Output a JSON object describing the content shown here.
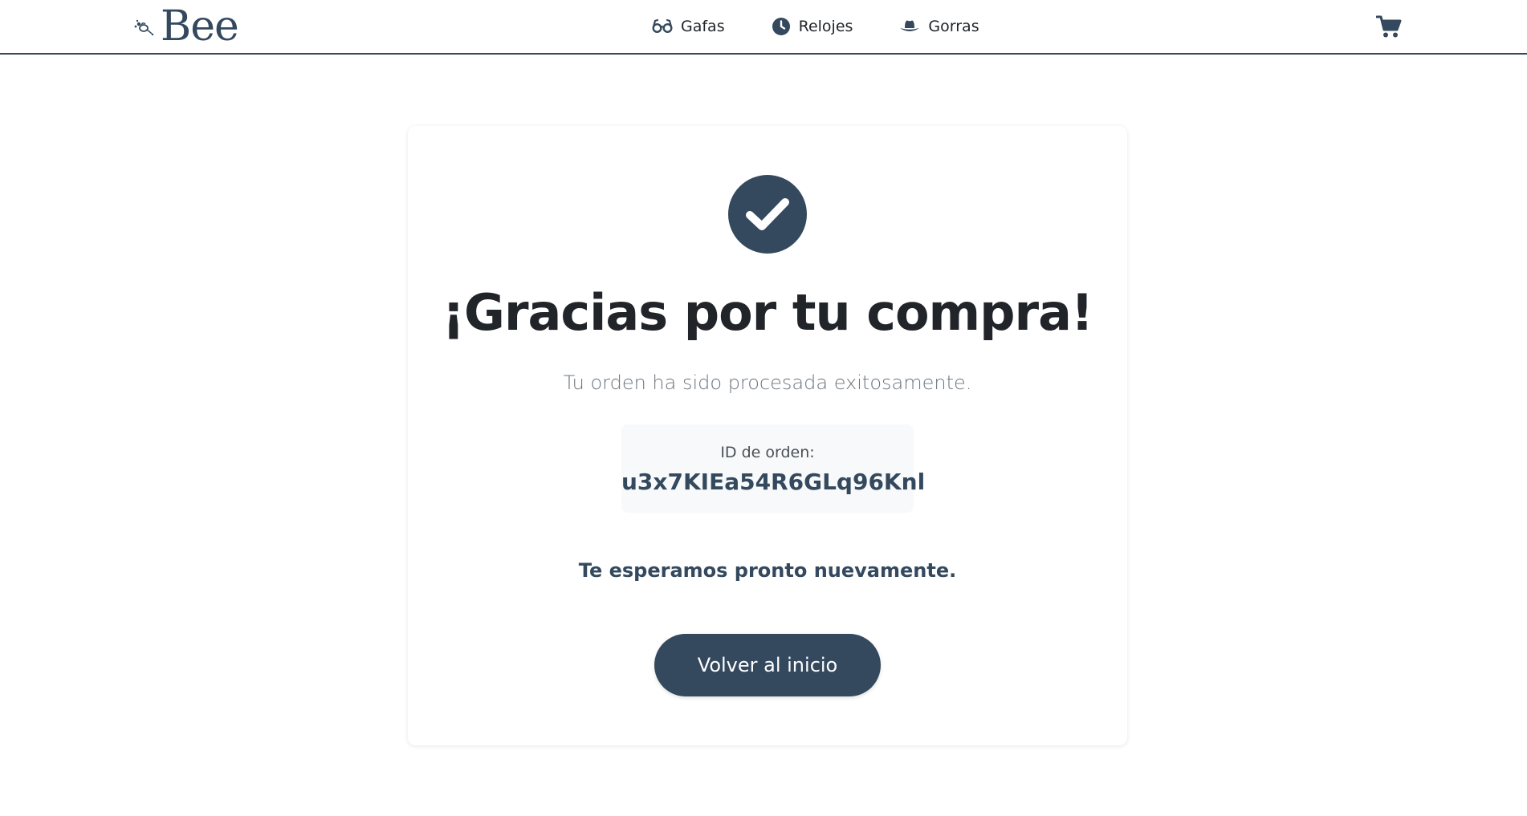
{
  "navbar": {
    "brand": "Bee",
    "links": [
      {
        "label": "Gafas",
        "icon": "glasses-icon"
      },
      {
        "label": "Relojes",
        "icon": "clock-icon"
      },
      {
        "label": "Gorras",
        "icon": "hat-icon"
      }
    ],
    "cart_icon": "shopping-cart-icon"
  },
  "confirmation": {
    "icon": "check-circle-icon",
    "title": "¡Gracias por tu compra!",
    "subtitle": "Tu orden ha sido procesada exitosamente.",
    "order_label": "ID de orden:",
    "order_id": "u3x7KIEa54R6GLq96Knl",
    "farewell": "Te esperamos pronto nuevamente.",
    "button_label": "Volver al inicio"
  },
  "colors": {
    "primary": "#34495e",
    "text": "#212529",
    "muted": "#6c757d",
    "box_bg": "#f8f9fa"
  }
}
